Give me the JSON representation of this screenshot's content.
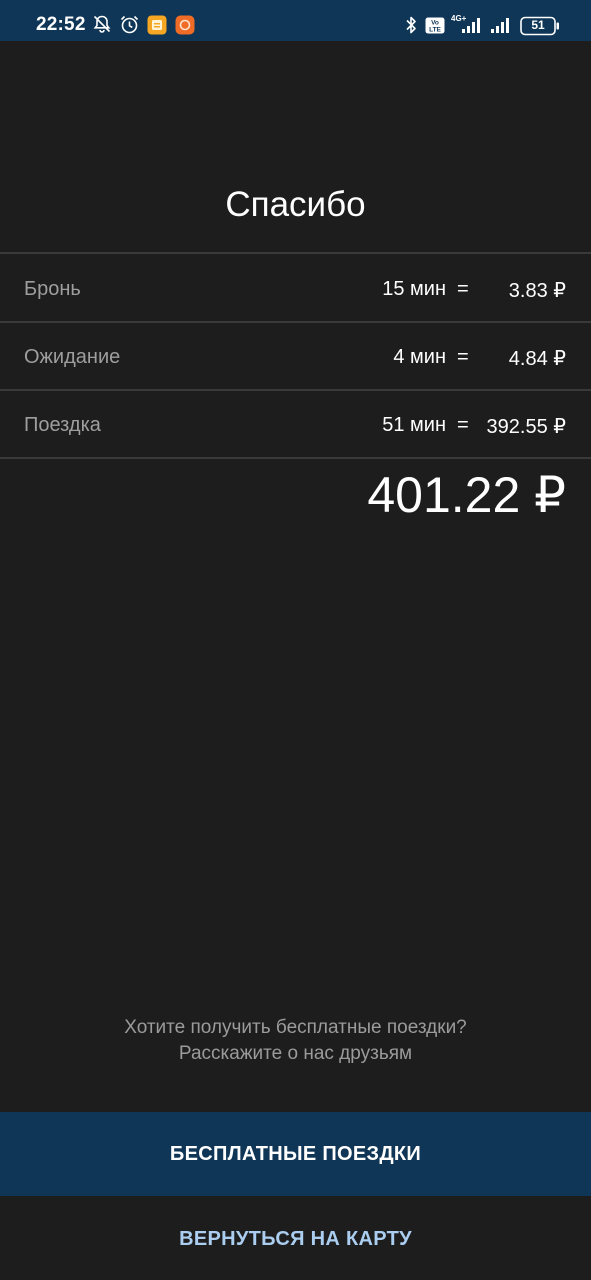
{
  "status_bar": {
    "time": "22:52",
    "battery": "51",
    "network": "4G+",
    "volte": "Vo LTE"
  },
  "screen": {
    "title": "Спасибо",
    "rows": [
      {
        "label": "Бронь",
        "minutes": "15 мин",
        "eq": "=",
        "amount": "3.83 ₽"
      },
      {
        "label": "Ожидание",
        "minutes": "4 мин",
        "eq": "=",
        "amount": "4.84 ₽"
      },
      {
        "label": "Поездка",
        "minutes": "51 мин",
        "eq": "=",
        "amount": "392.55 ₽"
      }
    ],
    "total": "401.22 ₽",
    "promo_line1": "Хотите получить бесплатные поездки?",
    "promo_line2": "Расскажите о нас друзьям"
  },
  "buttons": {
    "free_rides": "БЕСПЛАТНЫЕ ПОЕЗДКИ",
    "back_to_map": "ВЕРНУТЬСЯ НА КАРТУ"
  },
  "colors": {
    "background": "#1d1d1d",
    "status_bar": "#0f3656",
    "primary_button": "#0f3656",
    "secondary_button_text": "#aacdf0",
    "label_text": "#9e9e9e",
    "divider": "#3a3a3a"
  }
}
